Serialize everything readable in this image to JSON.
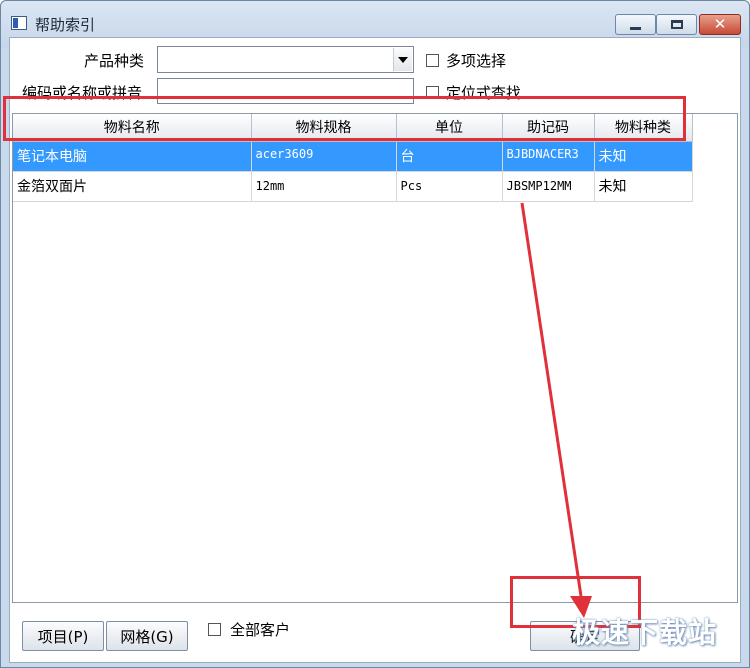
{
  "window": {
    "title": "帮助索引"
  },
  "filters": {
    "category_label": "产品种类",
    "category_value": "",
    "search_label": "编码或名称或拼音",
    "search_value": "",
    "multi_select_label": "多项选择",
    "locate_search_label": "定位式查找"
  },
  "table": {
    "columns": [
      "物料名称",
      "物料规格",
      "单位",
      "助记码",
      "物料种类"
    ],
    "rows": [
      [
        "笔记本电脑",
        "acer3609",
        "台",
        "BJBDNACER3",
        "未知"
      ],
      [
        "金箔双面片",
        "12mm",
        "Pcs",
        "JBSMP12MM",
        "未知"
      ]
    ],
    "selected_row": 0
  },
  "footer": {
    "project_button": "项目(P)",
    "grid_button": "网格(G)",
    "all_customers_label": "全部客户",
    "confirm_button": "确定"
  },
  "watermark": "极速下载站",
  "colors": {
    "selection": "#3399ff",
    "highlight": "#e0303a"
  }
}
